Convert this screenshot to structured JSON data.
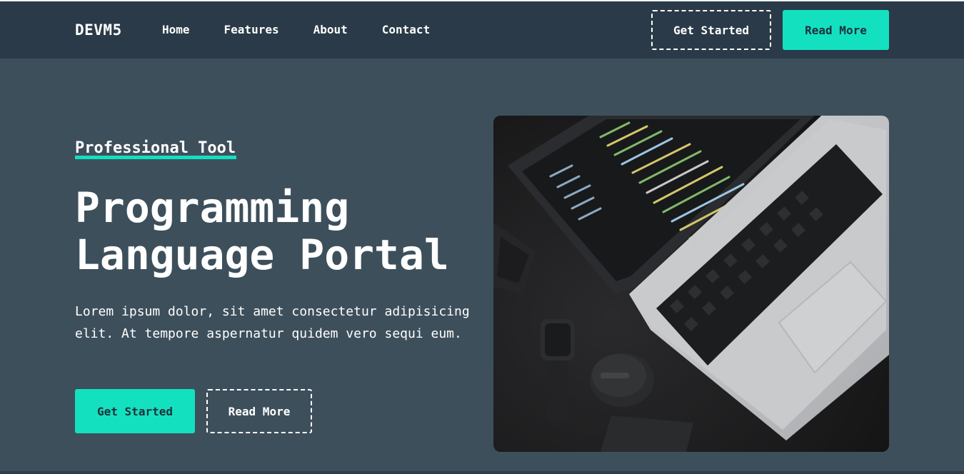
{
  "nav": {
    "brand": "DEVM5",
    "links": [
      "Home",
      "Features",
      "About",
      "Contact"
    ],
    "get_started": "Get Started",
    "read_more": "Read More"
  },
  "hero": {
    "eyebrow": "Professional Tool",
    "title_line1": "Programming",
    "title_line2": "Language Portal",
    "description": "Lorem ipsum dolor, sit amet consectetur adipisicing elit. At tempore aspernatur quidem vero sequi eum.",
    "get_started": "Get Started",
    "read_more": "Read More"
  },
  "colors": {
    "accent": "#13e0bf",
    "nav_background": "#2a3a48",
    "page_background": "#3d4f5b"
  }
}
